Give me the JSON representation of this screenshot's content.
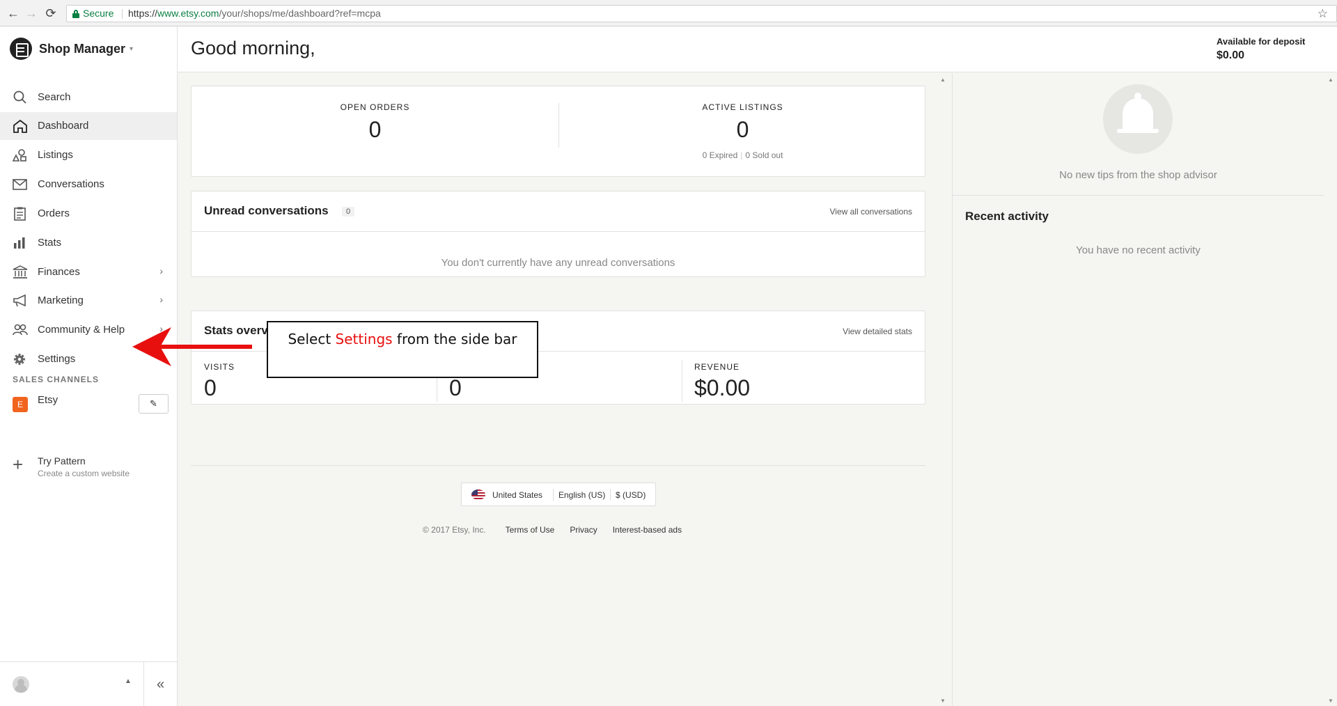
{
  "browser": {
    "secure_label": "Secure",
    "url_scheme": "https://",
    "url_host": "www.etsy.com",
    "url_path": "/your/shops/me/dashboard?ref=mcpa",
    "back_glyph": "←",
    "forward_glyph": "→",
    "reload_glyph": "⟳",
    "star_glyph": "☆"
  },
  "sidebar": {
    "title": "Shop Manager",
    "title_caret": "▾",
    "items": [
      {
        "label": "Search",
        "icon": "search-icon"
      },
      {
        "label": "Dashboard",
        "icon": "home-icon",
        "active": true
      },
      {
        "label": "Listings",
        "icon": "shapes-icon"
      },
      {
        "label": "Conversations",
        "icon": "envelope-icon"
      },
      {
        "label": "Orders",
        "icon": "clipboard-icon"
      },
      {
        "label": "Stats",
        "icon": "bar-chart-icon"
      },
      {
        "label": "Finances",
        "icon": "bank-icon",
        "chevron": "›"
      },
      {
        "label": "Marketing",
        "icon": "megaphone-icon",
        "chevron": "›"
      },
      {
        "label": "Community & Help",
        "icon": "people-icon",
        "chevron": "›"
      },
      {
        "label": "Settings",
        "icon": "gear-icon"
      }
    ],
    "sales_channels_title": "SALES CHANNELS",
    "etsy_channel": {
      "badge": "E",
      "label": "Etsy",
      "edit_glyph": "✎"
    },
    "pattern": {
      "plus_glyph": "+",
      "label": "Try Pattern",
      "sublabel": "Create a custom website"
    },
    "footer": {
      "caret": "▲",
      "collapse_glyph": "«"
    }
  },
  "header": {
    "greeting": "Good morning,",
    "deposit_label": "Available for deposit",
    "deposit_value": "$0.00"
  },
  "overview": {
    "open_orders_label": "OPEN ORDERS",
    "open_orders_value": "0",
    "active_listings_label": "ACTIVE LISTINGS",
    "active_listings_value": "0",
    "expired_text": "0 Expired",
    "sold_out_text": "0 Sold out"
  },
  "conversations": {
    "title": "Unread conversations",
    "count": "0",
    "link": "View all conversations",
    "empty_text": "You don't currently have any unread conversations"
  },
  "stats": {
    "title": "Stats overview",
    "link": "View detailed stats",
    "visits_label": "VISITS",
    "visits_value": "0",
    "orders_value": "0",
    "revenue_label": "REVENUE",
    "revenue_value": "$0.00"
  },
  "footer": {
    "country": "United States",
    "language": "English (US)",
    "currency": "$ (USD)",
    "copyright": "© 2017 Etsy, Inc.",
    "links": [
      "Terms of Use",
      "Privacy",
      "Interest-based ads"
    ]
  },
  "right_panel": {
    "tips_text": "No new tips from the shop advisor",
    "recent_title": "Recent activity",
    "recent_empty": "You have no recent activity"
  },
  "annotation": {
    "prefix": "Select ",
    "highlight": "Settings",
    "suffix": " from the side bar",
    "highlight_color": "#e8100f",
    "arrow_color": "#e8100f"
  },
  "colors": {
    "secure_green": "#0b8043",
    "etsy_orange": "#f1641e",
    "main_bg": "#f5f5f1",
    "active_nav_bg": "#efefef"
  }
}
